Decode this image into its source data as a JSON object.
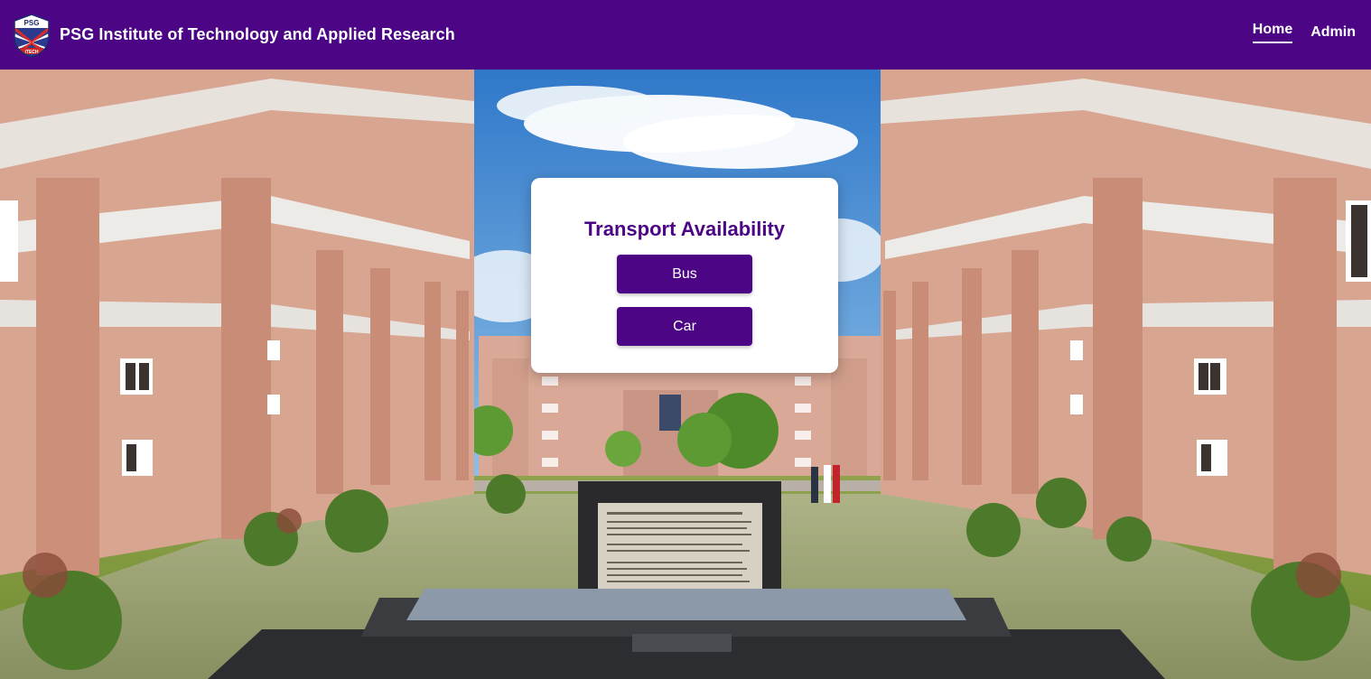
{
  "header": {
    "logo_text": "PSG",
    "logo_subtext": "iTECH",
    "title": "PSG Institute of Technology and Applied Research",
    "nav": [
      {
        "label": "Home",
        "active": true
      },
      {
        "label": "Admin",
        "active": false
      }
    ]
  },
  "card": {
    "title": "Transport Availability",
    "buttons": [
      {
        "label": "Bus"
      },
      {
        "label": "Car"
      }
    ]
  },
  "colors": {
    "brand": "#4b0585",
    "text_light": "#ffffff",
    "card_bg": "#ffffff"
  },
  "icons": {
    "logo": "psg-shield-logo"
  }
}
